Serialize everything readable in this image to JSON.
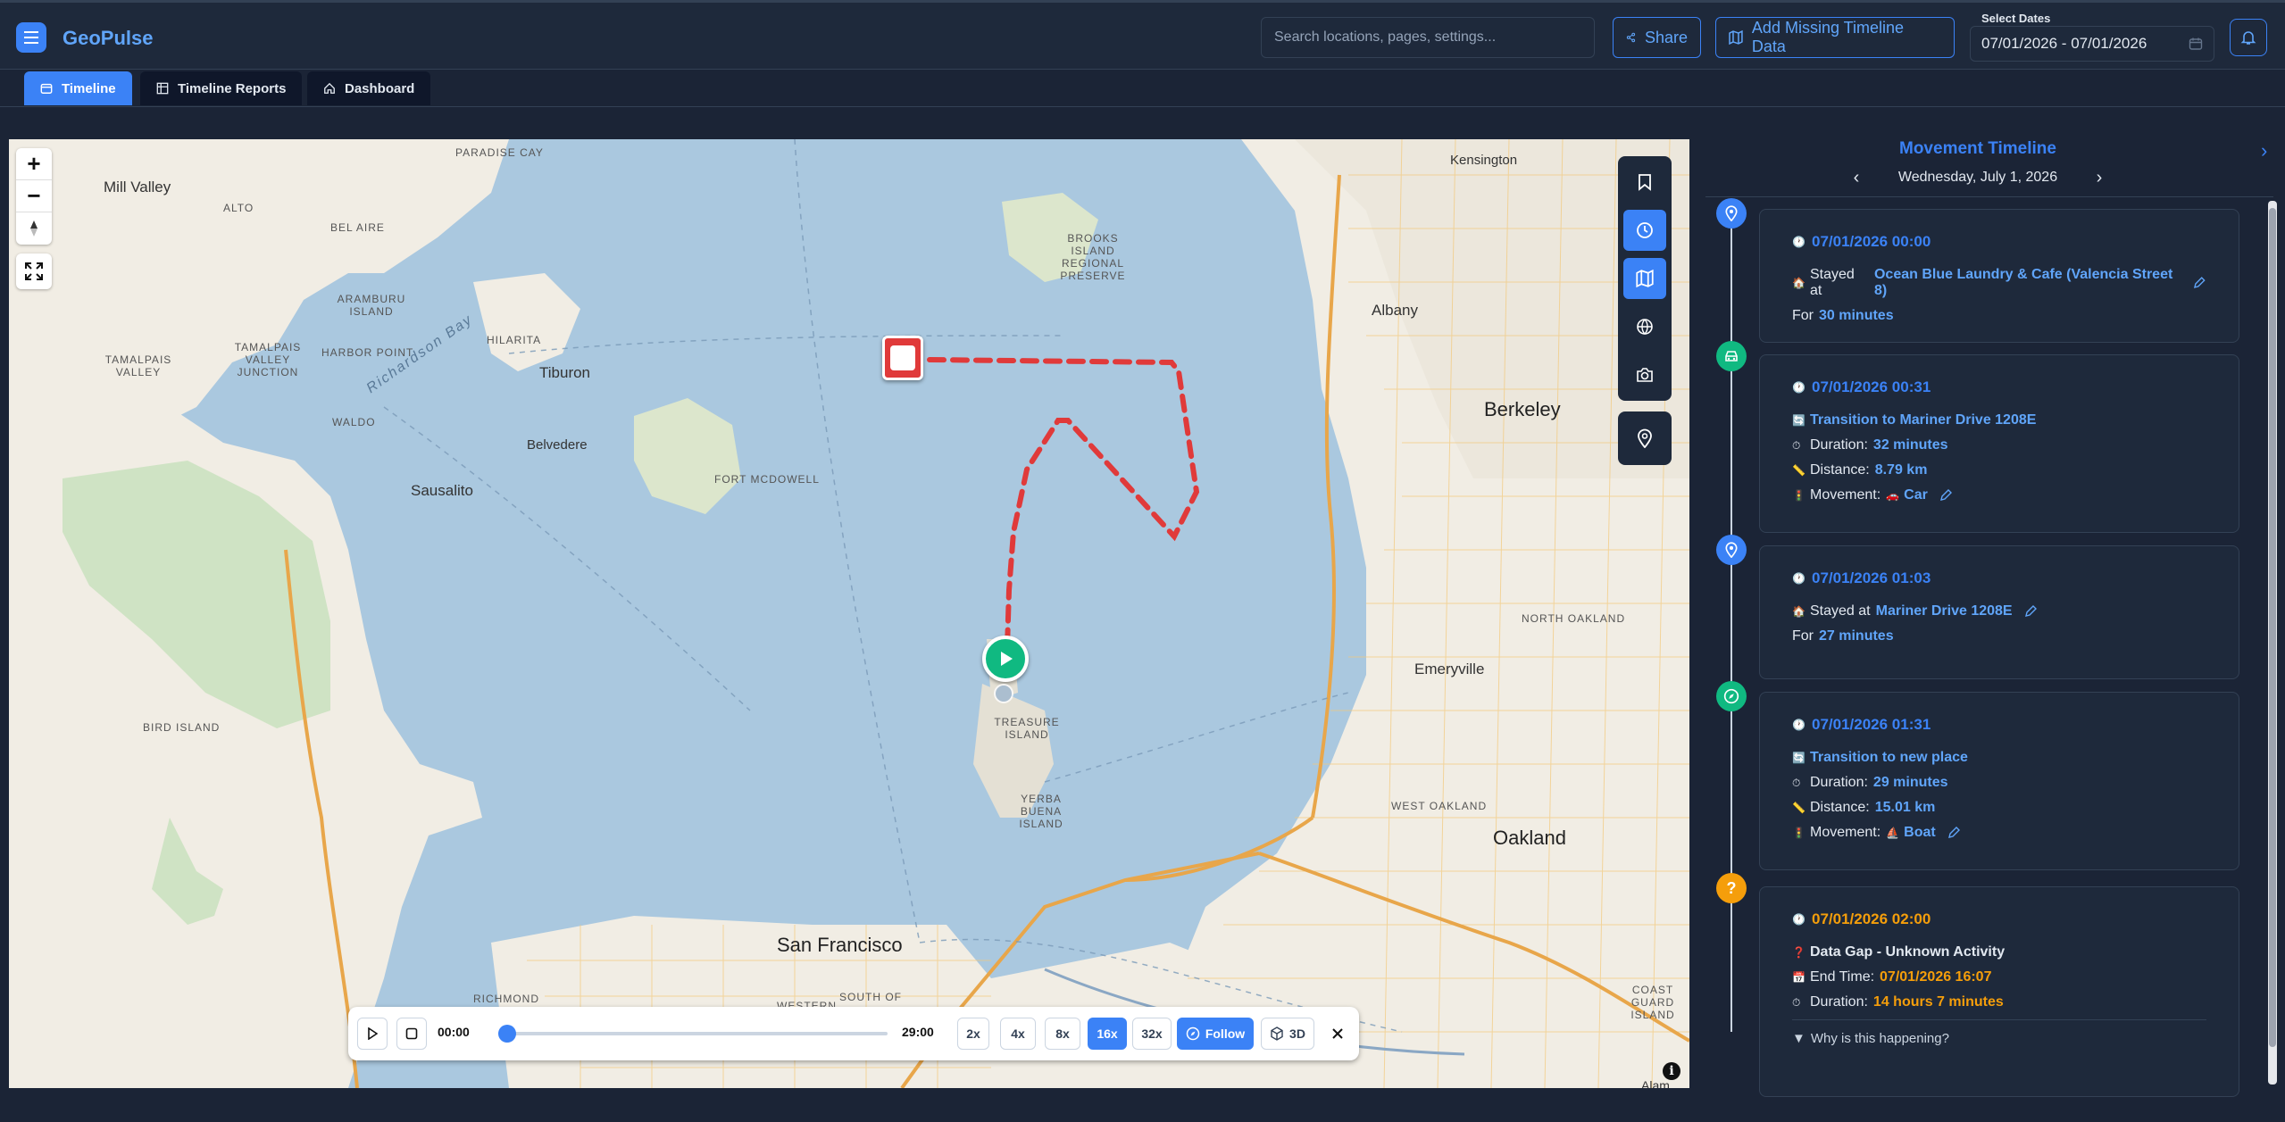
{
  "app": {
    "name": "GeoPulse"
  },
  "header": {
    "search_placeholder": "Search locations, pages, settings...",
    "share_label": "Share",
    "add_missing_label": "Add Missing Timeline Data",
    "date_label": "Select Dates",
    "date_range": "07/01/2026 - 07/01/2026"
  },
  "tabs": [
    {
      "label": "Timeline",
      "active": true
    },
    {
      "label": "Timeline Reports",
      "active": false
    },
    {
      "label": "Dashboard",
      "active": false
    }
  ],
  "map": {
    "labels": {
      "mill_valley": "Mill Valley",
      "alto": "ALTO",
      "bel_aire": "BEL AIRE",
      "aramburu": "ARAMBURU ISLAND",
      "tamalpais_jct": "TAMALPAIS VALLEY JUNCTION",
      "tamalpais_valley": "TAMALPAIS VALLEY",
      "harbor_point": "HARBOR POINT",
      "hilarita": "HILARITA",
      "tiburon": "Tiburon",
      "waldo": "WALDO",
      "belvedere": "Belvedere",
      "sausalito": "Sausalito",
      "fort_mcdowell": "FORT MCDOWELL",
      "paradise_cay": "PARADISE CAY",
      "brooks_island": "BROOKS ISLAND REGIONAL PRESERVE",
      "kensington": "Kensington",
      "albany": "Albany",
      "berkeley": "Berkeley",
      "north_oakland": "NORTH OAKLAND",
      "emeryville": "Emeryville",
      "west_oakland": "WEST OAKLAND",
      "oakland": "Oakland",
      "bird_island": "BIRD ISLAND",
      "treasure_island": "TREASURE ISLAND",
      "yerba_buena": "YERBA BUENA ISLAND",
      "san_francisco": "San Francisco",
      "richmond": "RICHMOND",
      "western": "WESTERN",
      "south_of": "SOUTH OF",
      "coast_guard": "COAST GUARD ISLAND",
      "richardson_bay": "Richardson Bay",
      "alameda_partial": "Alam"
    }
  },
  "player": {
    "start_time": "00:00",
    "end_time": "29:00",
    "progress": 0.0,
    "speeds": [
      "2x",
      "4x",
      "8x",
      "16x",
      "32x"
    ],
    "active_speed": "16x",
    "follow_label": "Follow",
    "threed_label": "3D"
  },
  "sidebar": {
    "title": "Movement Timeline",
    "date": "Wednesday, July 1, 2026",
    "items": [
      {
        "type": "stay",
        "time": "07/01/2026 00:00",
        "prefix": "Stayed at",
        "place": "Ocean Blue Laundry & Cafe (Valencia Street 8)",
        "for_prefix": "For",
        "duration": "30 minutes"
      },
      {
        "type": "trip",
        "time": "07/01/2026 00:31",
        "title": "Transition to Mariner Drive 1208E",
        "duration_label": "Duration:",
        "duration": "32 minutes",
        "distance_label": "Distance:",
        "distance": "8.79 km",
        "movement_label": "Movement:",
        "movement": "Car"
      },
      {
        "type": "stay",
        "time": "07/01/2026 01:03",
        "prefix": "Stayed at",
        "place": "Mariner Drive 1208E",
        "for_prefix": "For",
        "duration": "27 minutes"
      },
      {
        "type": "trip",
        "time": "07/01/2026 01:31",
        "title": "Transition to new place",
        "duration_label": "Duration:",
        "duration": "29 minutes",
        "distance_label": "Distance:",
        "distance": "15.01 km",
        "movement_label": "Movement:",
        "movement": "Boat"
      },
      {
        "type": "gap",
        "time": "07/01/2026 02:00",
        "title": "Data Gap - Unknown Activity",
        "end_label": "End Time:",
        "end_time": "07/01/2026 16:07",
        "duration_label": "Duration:",
        "duration": "14 hours 7 minutes",
        "why_label": "Why is this happening?"
      }
    ]
  },
  "colors": {
    "accent": "#3b82f6",
    "trip": "#10b981",
    "gap": "#f59e0b",
    "route": "#e03a3a"
  }
}
